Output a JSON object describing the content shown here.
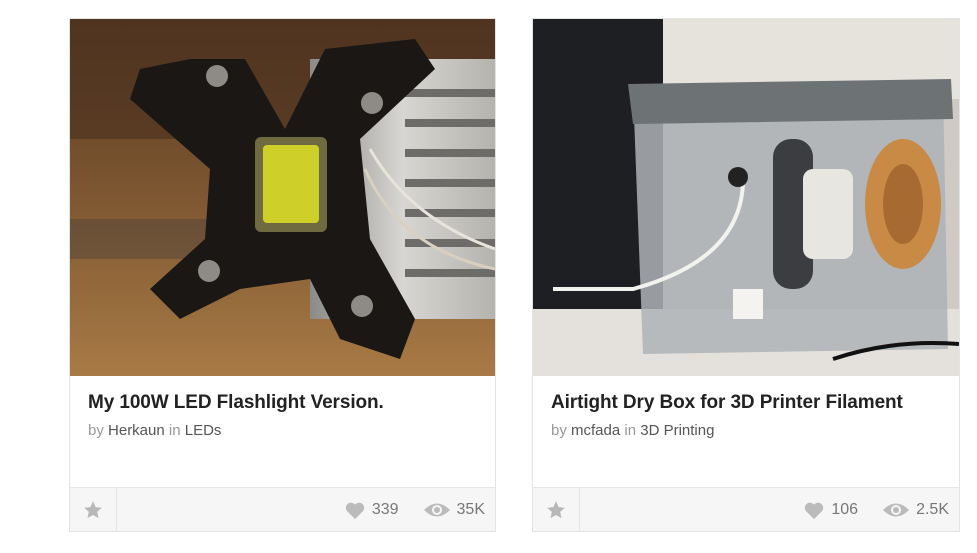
{
  "cards": [
    {
      "title": "My 100W LED Flashlight Version.",
      "by_label": "by",
      "author": "Herkaun",
      "in_label": "in",
      "category": "LEDs",
      "favorites": "339",
      "views": "35K",
      "image_icon": "led-heatsink-photo"
    },
    {
      "title": "Airtight Dry Box for 3D Printer Filament",
      "by_label": "by",
      "author": "mcfada",
      "in_label": "in",
      "category": "3D Printing",
      "favorites": "106",
      "views": "2.5K",
      "image_icon": "filament-dry-box-photo"
    }
  ],
  "icons": {
    "favorite": "star-icon",
    "likes": "heart-icon",
    "views": "eye-icon"
  },
  "colors": {
    "icon_gray": "#bbbbbb",
    "footer_bg": "#f6f6f6",
    "title": "#222222"
  }
}
